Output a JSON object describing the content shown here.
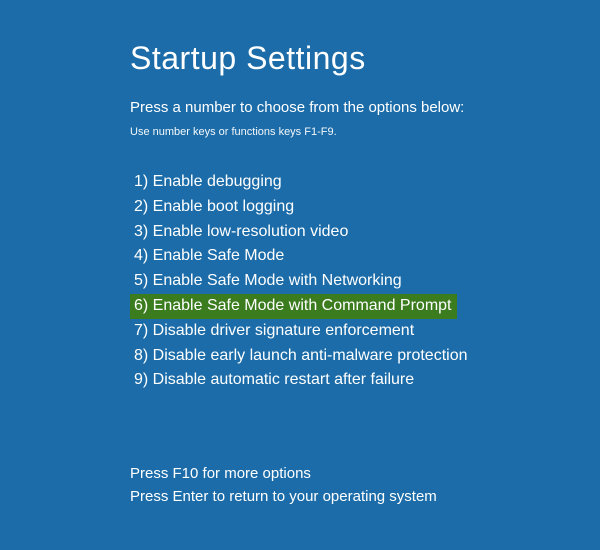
{
  "title": "Startup Settings",
  "instruction_primary": "Press a number to choose from the options below:",
  "instruction_secondary": "Use number keys or functions keys F1-F9.",
  "options": [
    {
      "n": 1,
      "label": "Enable debugging",
      "highlighted": false
    },
    {
      "n": 2,
      "label": "Enable boot logging",
      "highlighted": false
    },
    {
      "n": 3,
      "label": "Enable low-resolution video",
      "highlighted": false
    },
    {
      "n": 4,
      "label": "Enable Safe Mode",
      "highlighted": false
    },
    {
      "n": 5,
      "label": "Enable Safe Mode with Networking",
      "highlighted": false
    },
    {
      "n": 6,
      "label": "Enable Safe Mode with Command Prompt",
      "highlighted": true
    },
    {
      "n": 7,
      "label": "Disable driver signature enforcement",
      "highlighted": false
    },
    {
      "n": 8,
      "label": "Disable early launch anti-malware protection",
      "highlighted": false
    },
    {
      "n": 9,
      "label": "Disable automatic restart after failure",
      "highlighted": false
    }
  ],
  "footer": {
    "more_options": "Press F10 for more options",
    "return": "Press Enter to return to your operating system"
  },
  "colors": {
    "background": "#1b6ca8",
    "highlight": "#3a7c1e",
    "text": "#ffffff"
  }
}
